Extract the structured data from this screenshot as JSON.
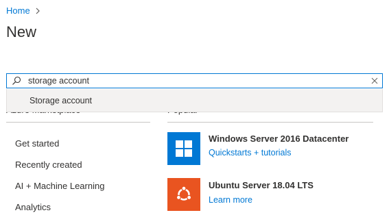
{
  "breadcrumb": {
    "home": "Home"
  },
  "page": {
    "title": "New"
  },
  "search": {
    "value": "storage account"
  },
  "suggestions": [
    "Storage account"
  ],
  "sections": {
    "marketplace": "Azure Marketplace",
    "popular": "Popular"
  },
  "categories": [
    "Get started",
    "Recently created",
    "AI + Machine Learning",
    "Analytics"
  ],
  "offers": [
    {
      "title": "Windows Server 2016 Datacenter",
      "link": "Quickstarts + tutorials",
      "icon": "windows-logo-icon",
      "color": "#0078d4"
    },
    {
      "title": "Ubuntu Server 18.04 LTS",
      "link": "Learn more",
      "icon": "ubuntu-logo-icon",
      "color": "#e95420"
    }
  ],
  "colors": {
    "accent": "#0078d4"
  }
}
